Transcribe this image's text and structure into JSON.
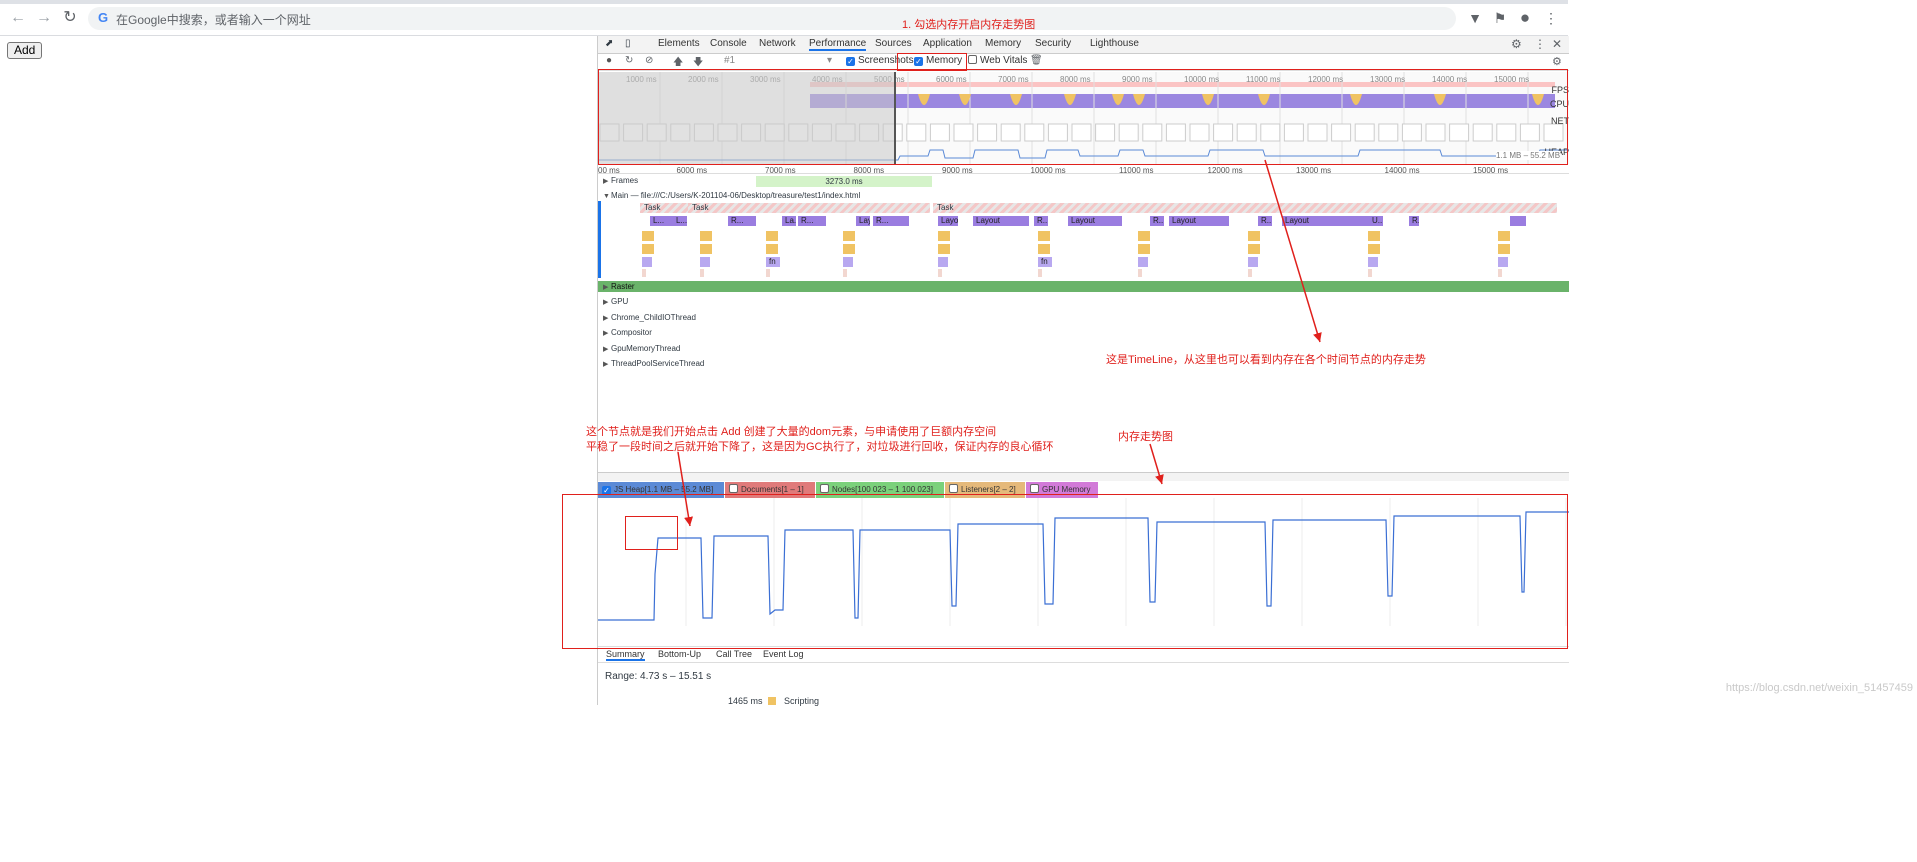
{
  "browser": {
    "omnibox_text": "在Google中搜索，或者输入一个网址",
    "google_glyph": "G"
  },
  "page": {
    "add_button": "Add"
  },
  "devtools": {
    "tabs": [
      "Elements",
      "Console",
      "Network",
      "Performance",
      "Sources",
      "Application",
      "Memory",
      "Security",
      "Lighthouse"
    ],
    "active_tab": "Performance",
    "toolbar": {
      "profile_select": "#1",
      "screenshots_label": "Screenshots",
      "memory_label": "Memory",
      "webvitals_label": "Web Vitals",
      "screenshots_checked": true,
      "memory_checked": true,
      "webvitals_checked": false
    },
    "overview": {
      "ticks": [
        "1000 ms",
        "2000 ms",
        "3000 ms",
        "4000 ms",
        "5000 ms",
        "6000 ms",
        "7000 ms",
        "8000 ms",
        "9000 ms",
        "10000 ms",
        "11000 ms",
        "12000 ms",
        "13000 ms",
        "14000 ms",
        "15000 ms"
      ],
      "labels": [
        "FPS",
        "CPU",
        "NET",
        "HEAP"
      ],
      "heap_range": "1.1 MB – 55.2 MB"
    },
    "ruler": [
      "00 ms",
      "6000 ms",
      "7000 ms",
      "8000 ms",
      "9000 ms",
      "10000 ms",
      "11000 ms",
      "12000 ms",
      "13000 ms",
      "14000 ms",
      "15000 ms"
    ],
    "frames_label": "Frames",
    "frames_value": "3273.0 ms",
    "main_label": "Main — file:///C:/Users/K-201104-06/Desktop/treasure/test1/index.html",
    "task_label": "Task",
    "flame_labels": [
      "L...",
      "L...t",
      "R...",
      "La...ut",
      "R...",
      "Layout",
      "R...",
      "Layout",
      "Layout",
      "R...",
      "Layout",
      "R...",
      "Layout",
      "R...",
      "Layout",
      "U...",
      "R..."
    ],
    "fn_label": "fn",
    "threads": [
      "Raster",
      "GPU",
      "Chrome_ChildIOThread",
      "Compositor",
      "GpuMemoryThread",
      "ThreadPoolServiceThread"
    ],
    "legend": [
      {
        "label": "JS Heap[1.1 MB – 55.2 MB]",
        "checked": true,
        "color": "#5b8ad6"
      },
      {
        "label": "Documents[1 – 1]",
        "checked": false,
        "color": "#e07a7a"
      },
      {
        "label": "Nodes[100 023 – 1 100 023]",
        "checked": false,
        "color": "#7bd17b"
      },
      {
        "label": "Listeners[2 – 2]",
        "checked": false,
        "color": "#e5b97a"
      },
      {
        "label": "GPU Memory",
        "checked": false,
        "color": "#d27ad8"
      }
    ],
    "bottom_tabs": [
      "Summary",
      "Bottom-Up",
      "Call Tree",
      "Event Log"
    ],
    "active_bottom_tab": "Summary",
    "range": "Range: 4.73 s – 15.51 s",
    "summary_ms": "1465 ms",
    "summary_category": "Scripting"
  },
  "annotations": {
    "step1": "1. 勾选内存开启内存走势图",
    "timeline_note": "这是TimeLine，从这里也可以看到内存在各个时间节点的内存走势",
    "node_note_line1": "这个节点就是我们开始点击 Add 创建了大量的dom元素，与申请使用了巨额内存空间",
    "node_note_line2": "平稳了一段时间之后就开始下降了，这是因为GC执行了，对垃圾进行回收，保证内存的良心循环",
    "memory_trend": "内存走势图",
    "watermark": "https://blog.csdn.net/weixin_51457459"
  },
  "colors": {
    "annotation_red": "#e0201c",
    "heap_line": "#3b6fd4",
    "accent": "#1a73e8"
  }
}
